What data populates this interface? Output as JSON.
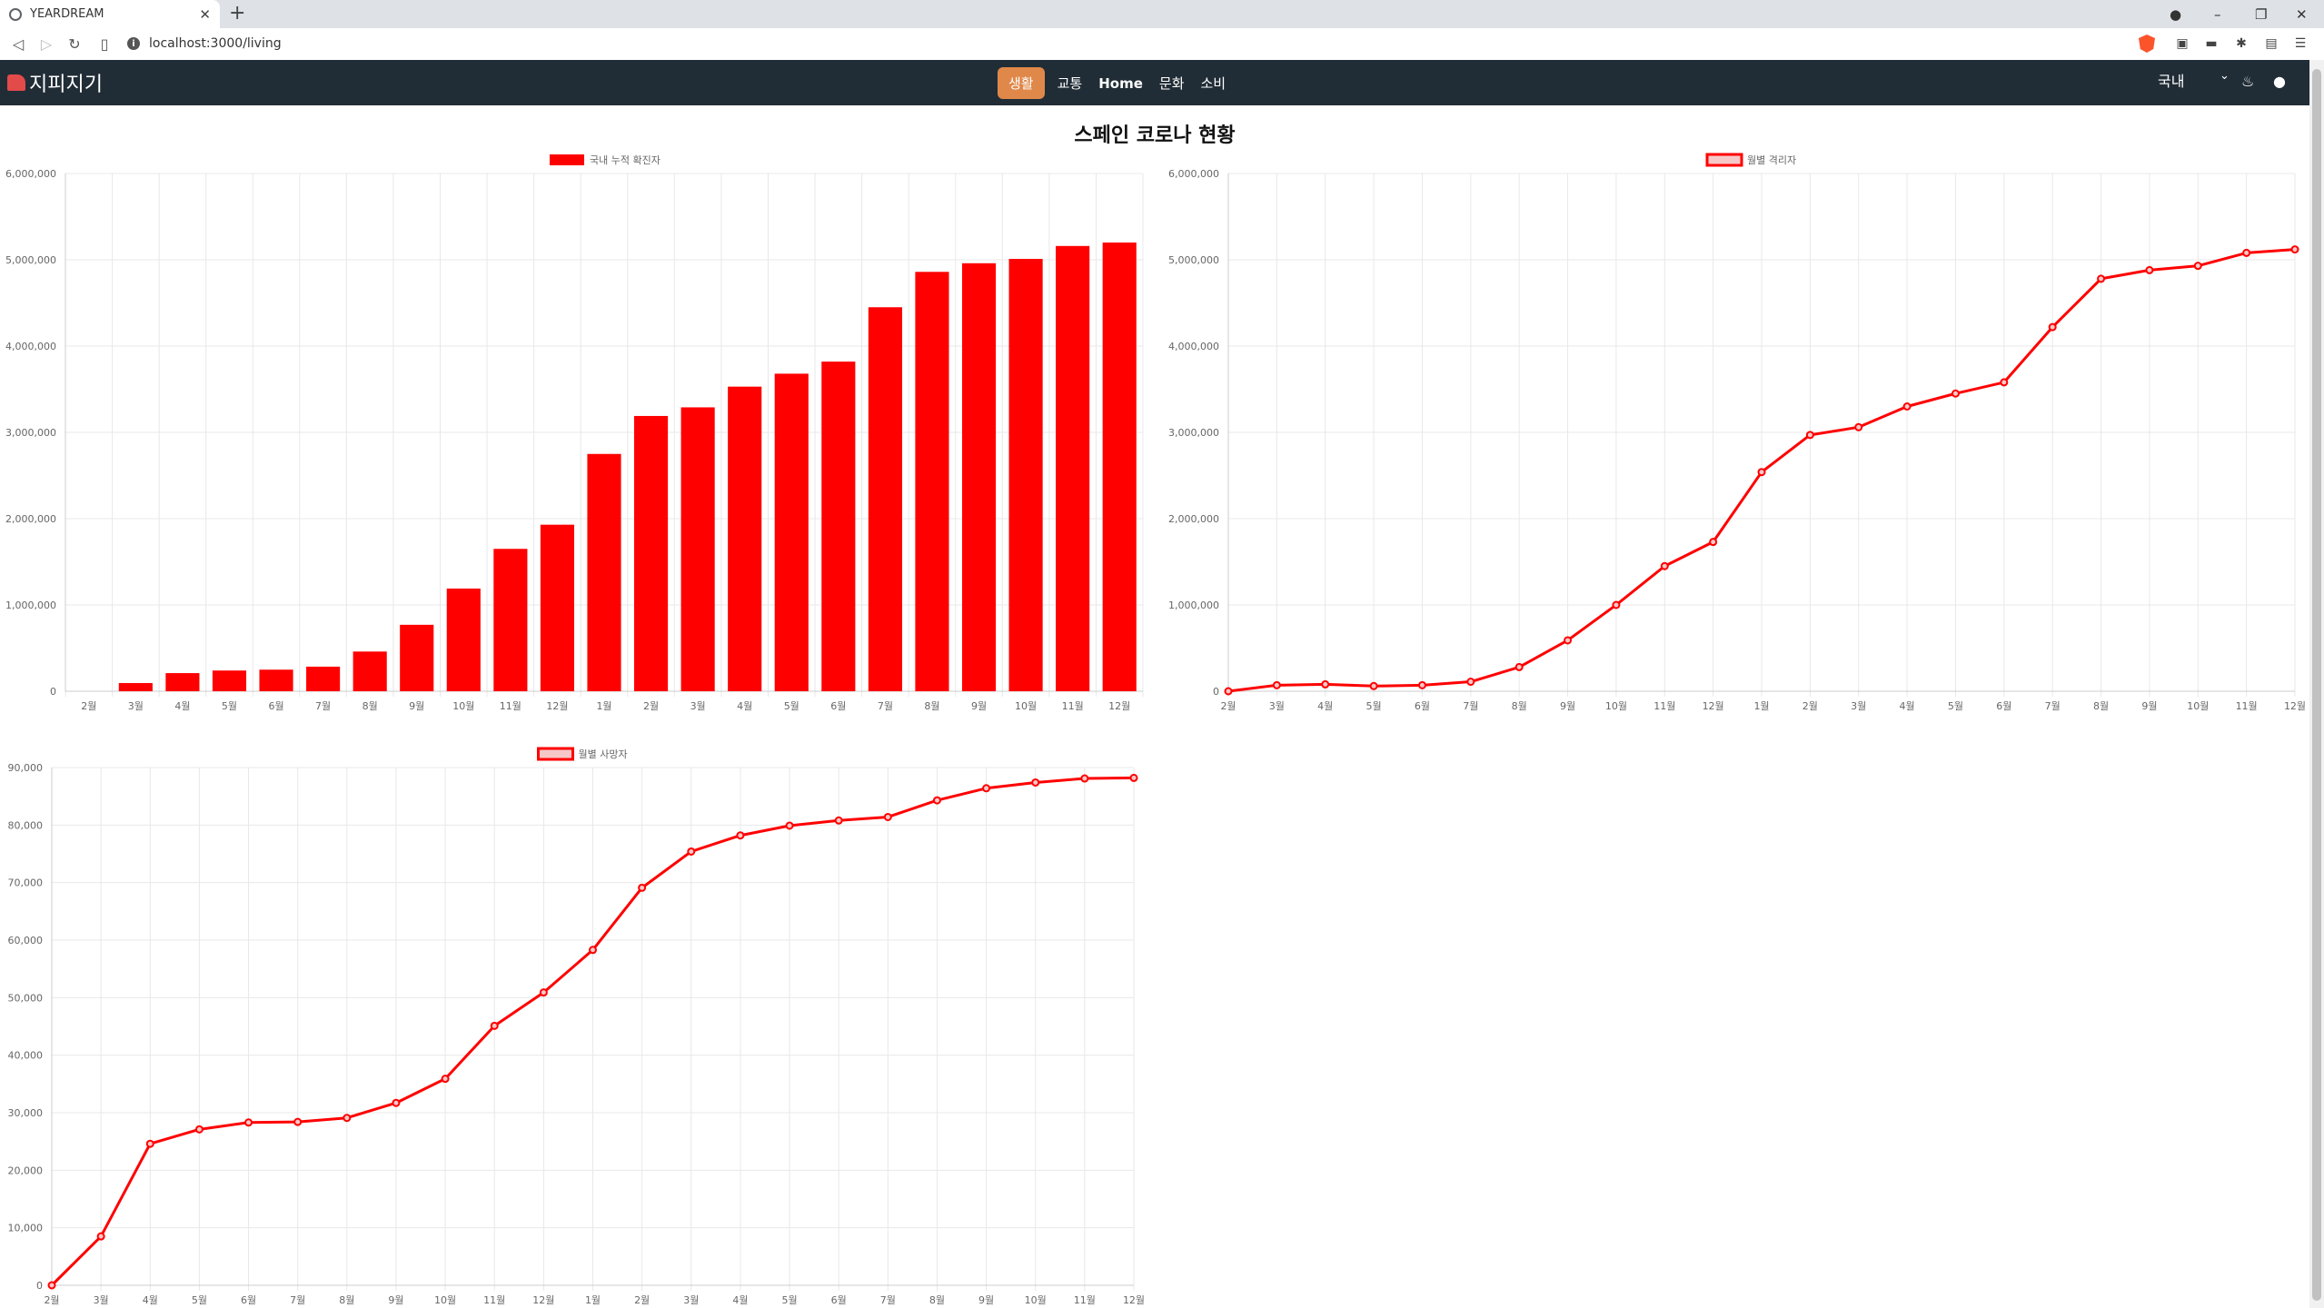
{
  "browser": {
    "tab_title": "YEARDREAM",
    "url": "localhost:3000/living"
  },
  "navbar": {
    "brand": "지피지기",
    "menu": [
      {
        "label": "생활",
        "active": true
      },
      {
        "label": "교통",
        "active": false
      },
      {
        "label": "Home",
        "active": false
      },
      {
        "label": "문화",
        "active": false
      },
      {
        "label": "소비",
        "active": false
      }
    ],
    "region_select": "국내"
  },
  "page": {
    "title": "스페인 코로나 현황"
  },
  "colors": {
    "series": "#ff0000",
    "fill_light": "#f7c8c8",
    "grid": "#e8e8e8",
    "navbar": "#212d36",
    "active_menu": "#e0884a"
  },
  "chart_data": [
    {
      "type": "bar",
      "legend": "국내 누적 확진자",
      "categories": [
        "2월",
        "3월",
        "4월",
        "5월",
        "6월",
        "7월",
        "8월",
        "9월",
        "10월",
        "11월",
        "12월",
        "1월",
        "2월",
        "3월",
        "4월",
        "5월",
        "6월",
        "7월",
        "8월",
        "9월",
        "10월",
        "11월",
        "12월"
      ],
      "values": [
        0,
        95000,
        210000,
        240000,
        250000,
        285000,
        460000,
        770000,
        1190000,
        1650000,
        1930000,
        2750000,
        3190000,
        3290000,
        3530000,
        3680000,
        3820000,
        4450000,
        4860000,
        4960000,
        5010000,
        5160000,
        5200000
      ],
      "yticks": [
        "0",
        "1,000,000",
        "2,000,000",
        "3,000,000",
        "4,000,000",
        "5,000,000",
        "6,000,000"
      ],
      "ylim": [
        0,
        6000000
      ],
      "grid": true,
      "legend_position": "top-center"
    },
    {
      "type": "line",
      "legend": "월별 격리자",
      "categories": [
        "2월",
        "3월",
        "4월",
        "5월",
        "6월",
        "7월",
        "8월",
        "9월",
        "10월",
        "11월",
        "12월",
        "1월",
        "2월",
        "3월",
        "4월",
        "5월",
        "6월",
        "7월",
        "8월",
        "9월",
        "10월",
        "11월",
        "12월"
      ],
      "values": [
        0,
        70000,
        80000,
        60000,
        70000,
        110000,
        280000,
        590000,
        1000000,
        1450000,
        1730000,
        2540000,
        2970000,
        3060000,
        3300000,
        3450000,
        3580000,
        4220000,
        4780000,
        4880000,
        4930000,
        5080000,
        5120000
      ],
      "yticks": [
        "0",
        "1,000,000",
        "2,000,000",
        "3,000,000",
        "4,000,000",
        "5,000,000",
        "6,000,000"
      ],
      "ylim": [
        0,
        6000000
      ],
      "grid": true,
      "legend_position": "top-center"
    },
    {
      "type": "line",
      "legend": "월별 사망자",
      "categories": [
        "2월",
        "3월",
        "4월",
        "5월",
        "6월",
        "7월",
        "8월",
        "9월",
        "10월",
        "11월",
        "12월",
        "1월",
        "2월",
        "3월",
        "4월",
        "5월",
        "6월",
        "7월",
        "8월",
        "9월",
        "10월",
        "11월",
        "12월"
      ],
      "values": [
        0,
        8500,
        24600,
        27100,
        28300,
        28400,
        29100,
        31700,
        35900,
        45100,
        50900,
        58300,
        69100,
        75400,
        78200,
        79900,
        80800,
        81400,
        84300,
        86400,
        87400,
        88100,
        88200
      ],
      "yticks": [
        "0",
        "10,000",
        "20,000",
        "30,000",
        "40,000",
        "50,000",
        "60,000",
        "70,000",
        "80,000",
        "90,000"
      ],
      "ylim": [
        0,
        90000
      ],
      "grid": true,
      "legend_position": "top-center"
    }
  ]
}
